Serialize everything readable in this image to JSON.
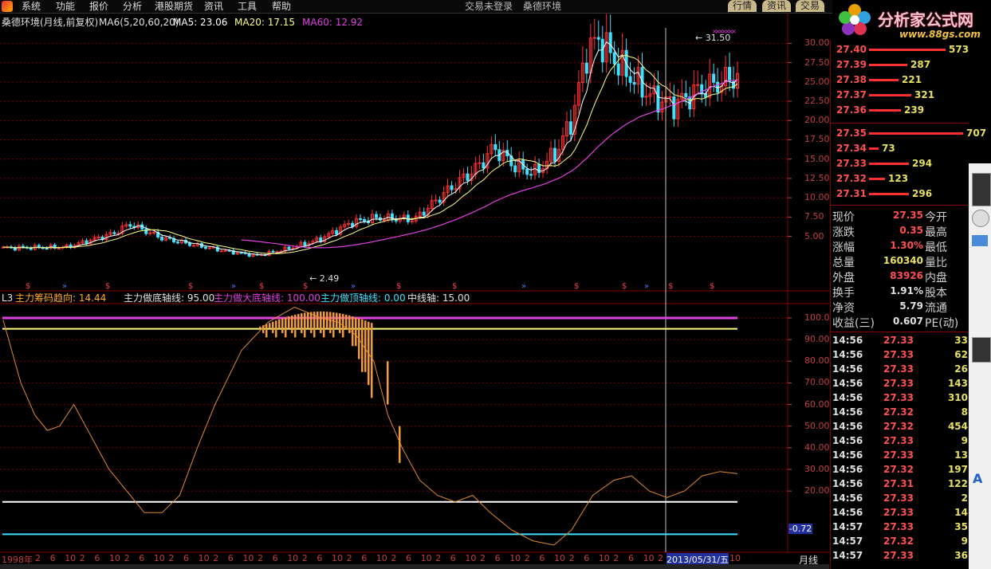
{
  "menu": {
    "items": [
      "系统",
      "功能",
      "报价",
      "分析",
      "港股期货",
      "资讯",
      "工具",
      "帮助"
    ],
    "center_titles": [
      "交易未登录",
      "桑德环境"
    ],
    "tabs": [
      "行情",
      "资讯",
      "交易"
    ]
  },
  "brand": {
    "name": "分析家公式网",
    "url": "www.88gs.com"
  },
  "main_chart": {
    "title": "桑德环境(月线,前复权)",
    "ma_params": "MA6(5,20,60,20)",
    "ma5": "MA5: 23.06",
    "ma20": "MA20: 17.15",
    "ma60": "MA60: 12.92",
    "colors": {
      "ma5": "#ffffff",
      "ma20": "#ffff80",
      "ma60": "#e040e0",
      "up": "#ff3030",
      "down": "#40e0ff"
    }
  },
  "indicator": {
    "name": "L3",
    "l1": "主力筹码趋向: 14.44",
    "l2": "主力做底轴线: 95.00",
    "l3": "主力做大底轴线: 100.00",
    "l4": "主力做顶轴线: 0.00",
    "l5": "中线轴: 15.00",
    "cursor_value": "-0.72"
  },
  "chart_data": {
    "type": "line",
    "price_axis": [
      30.0,
      27.5,
      25.0,
      22.5,
      20.0,
      17.5,
      15.0,
      12.5,
      10.0,
      7.5,
      5.0
    ],
    "indicator_axis": [
      100.0,
      90.0,
      80.0,
      70.0,
      60.0,
      50.0,
      40.0,
      30.0,
      20.0
    ],
    "annotations": {
      "high": "31.50",
      "low": "2.49"
    },
    "x_ticks": [
      "1998年",
      "2",
      "6",
      "10",
      "2",
      "6",
      "10",
      "2",
      "6",
      "10",
      "2",
      "6",
      "10",
      "2",
      "6",
      "10",
      "2",
      "6",
      "10",
      "2",
      "6",
      "10",
      "2",
      "6",
      "10",
      "2",
      "6",
      "10",
      "2",
      "6",
      "10",
      "2",
      "6",
      "10",
      "2",
      "6",
      "10",
      "2",
      "6",
      "10",
      "2",
      "6",
      "10",
      "2",
      "2013/05/31/五",
      "10"
    ],
    "period": "月线"
  },
  "order_book": {
    "asks": [
      {
        "price": "27.40",
        "vol": "573",
        "w": 0.81
      },
      {
        "price": "27.39",
        "vol": "287",
        "w": 0.41
      },
      {
        "price": "27.38",
        "vol": "221",
        "w": 0.31
      },
      {
        "price": "27.37",
        "vol": "321",
        "w": 0.45
      },
      {
        "price": "27.36",
        "vol": "239",
        "w": 0.34
      }
    ],
    "bids": [
      {
        "price": "27.35",
        "vol": "707",
        "w": 1.0
      },
      {
        "price": "27.34",
        "vol": "73",
        "w": 0.1
      },
      {
        "price": "27.33",
        "vol": "294",
        "w": 0.42
      },
      {
        "price": "27.32",
        "vol": "123",
        "w": 0.17
      },
      {
        "price": "27.31",
        "vol": "296",
        "w": 0.42
      }
    ]
  },
  "quote": {
    "rows": [
      {
        "k": "现价",
        "v": "27.35",
        "k2": "今开",
        "c": "#ff5050"
      },
      {
        "k": "涨跌",
        "v": "0.35",
        "k2": "最高",
        "c": "#ff5050"
      },
      {
        "k": "涨幅",
        "v": "1.30%",
        "k2": "最低",
        "c": "#ff5050"
      },
      {
        "k": "总量",
        "v": "160340",
        "k2": "量比",
        "c": "#e8e060"
      },
      {
        "k": "外盘",
        "v": "83926",
        "k2": "内盘",
        "c": "#ff5050"
      },
      {
        "k": "换手",
        "v": "1.91%",
        "k2": "股本",
        "c": "#e0e0e0"
      },
      {
        "k": "净资",
        "v": "5.79",
        "k2": "流通",
        "c": "#e0e0e0"
      },
      {
        "k": "收益(三)",
        "v": "0.607",
        "k2": "PE(动)",
        "c": "#e0e0e0"
      }
    ]
  },
  "ticks": [
    {
      "t": "14:56",
      "p": "27.33",
      "v": "33"
    },
    {
      "t": "14:56",
      "p": "27.33",
      "v": "62"
    },
    {
      "t": "14:56",
      "p": "27.33",
      "v": "26"
    },
    {
      "t": "14:56",
      "p": "27.33",
      "v": "143"
    },
    {
      "t": "14:56",
      "p": "27.33",
      "v": "310"
    },
    {
      "t": "14:56",
      "p": "27.32",
      "v": "8"
    },
    {
      "t": "14:56",
      "p": "27.32",
      "v": "454"
    },
    {
      "t": "14:56",
      "p": "27.33",
      "v": "9"
    },
    {
      "t": "14:56",
      "p": "27.33",
      "v": "13"
    },
    {
      "t": "14:56",
      "p": "27.32",
      "v": "197"
    },
    {
      "t": "14:56",
      "p": "27.31",
      "v": "122"
    },
    {
      "t": "14:56",
      "p": "27.33",
      "v": "2"
    },
    {
      "t": "14:56",
      "p": "27.33",
      "v": "14"
    },
    {
      "t": "14:57",
      "p": "27.33",
      "v": "35"
    },
    {
      "t": "14:57",
      "p": "27.32",
      "v": "9"
    },
    {
      "t": "14:57",
      "p": "27.33",
      "v": "36"
    }
  ]
}
